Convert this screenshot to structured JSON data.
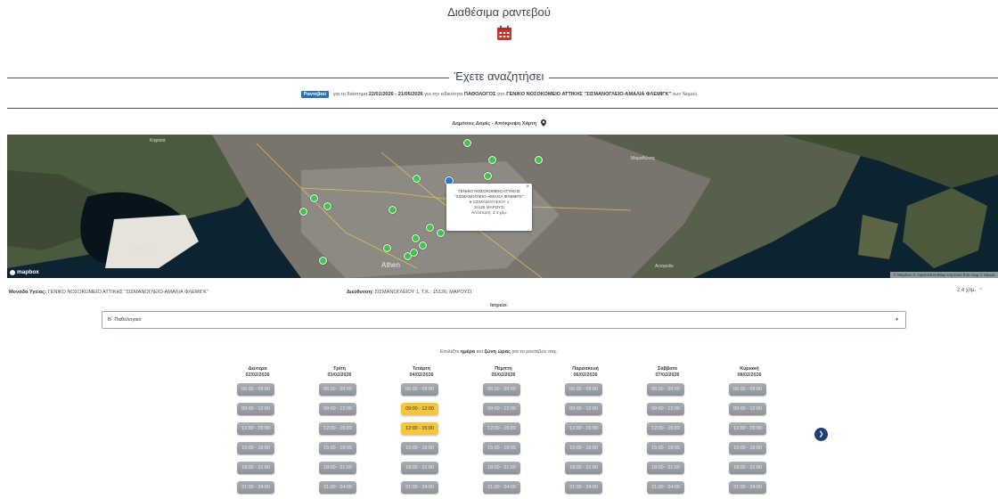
{
  "page_title": "Διαθέσιμα ραντεβού",
  "section_title": "Έχετε αναζητήσει",
  "search_summary": {
    "badge": "Ραντεβού",
    "text1": "για το διάστημα",
    "date_range": "22/01/2026 - 21/05/2026",
    "text2": "για την ειδικότητα",
    "specialty": "ΠΑΘΟΛΟΓΟΣ",
    "text3": "στο",
    "hospital": "ΓΕΝΙΚΟ ΝΟΣΟΚΟΜΕΙΟ ΑΤΤΙΚΗΣ \"ΣΙΣΜΑΝΟΓΛΕΙΟ-ΑΜΑΛΙΑ ΦΛΕΜΙΓΚ\"",
    "text4": "των Νομού"
  },
  "public_sort_label": "Δημόσιες Δομές - Απόκρυψη Χάρτη",
  "map": {
    "popup": {
      "line1": "ΓΕΝΙΚΟ ΝΟΣΟΚΟΜΕΙΟ ΑΤΤΙΚΗΣ",
      "line2": "\"ΣΙΣΜΑΝΟΓΛΕΙΟ-ΑΜΑΛΙΑ ΦΛΕΜΙΓΚ\"",
      "line3": "ΣΙΣΜΑΝΟΓΛΕΙΟΥ 1",
      "line4": "15126 ΜΑΡΟΥΣΙ",
      "line5": "Απόσταση: 2.4 χλμ.",
      "close": "×"
    },
    "labels": {
      "athen": "Athen",
      "kifisia": "Κηφισιά",
      "marathon": "Μαραθώνας",
      "acropolis": "Acropolis",
      "salamina": "Σαλαμίνα"
    },
    "logo": "mapbox",
    "attribution": "© Mapbox © OpenStreetMap Improve this map © Maxar"
  },
  "health_unit": {
    "label": "Μονάδα Υγείας:",
    "value": "ΓΕΝΙΚΟ ΝΟΣΟΚΟΜΕΙΟ ΑΤΤΙΚΗΣ \"ΣΙΣΜΑΝΟΓΛΕΙΟ-ΑΜΑΛΙΑ ΦΛΕΜΙΓΚ\""
  },
  "address": {
    "label": "Διεύθυνση:",
    "value": "ΣΙΣΜΑΝΟΓΛΕΙΟΥ 1, Τ.Κ.: 15126, ΜΑΡΟΥΣΙ"
  },
  "distance": "2.4 χλμ.",
  "doctor": {
    "label": "Ιατρείο:",
    "value": "Β΄ Παθολογικό"
  },
  "instruction": {
    "pre": "Επιλέξτε",
    "day": "ημέρα",
    "mid": "και",
    "zone": "ζώνη ώρας",
    "post": "για το ραντεβού σας:"
  },
  "days": [
    {
      "name": "Δευτέρα",
      "date": "02/02/2026"
    },
    {
      "name": "Τρίτη",
      "date": "03/02/2026"
    },
    {
      "name": "Τετάρτη",
      "date": "04/02/2026"
    },
    {
      "name": "Πέμπτη",
      "date": "05/02/2026"
    },
    {
      "name": "Παρασκευή",
      "date": "06/02/2026"
    },
    {
      "name": "Σάββατο",
      "date": "07/02/2026"
    },
    {
      "name": "Κυριακή",
      "date": "08/02/2026"
    }
  ],
  "time_slots": [
    "06:00 - 09:00",
    "09:00 - 12:00",
    "12:00 - 15:00",
    "15:00 - 18:00",
    "18:00 - 21:00",
    "21:00 - 24:00"
  ],
  "available": [
    {
      "day": 2,
      "slot": 1
    },
    {
      "day": 2,
      "slot": 2
    }
  ],
  "next_icon": "chevron-right-icon",
  "colors": {
    "available": "#f4c53f",
    "unavailable": "#9aa0a6",
    "accent": "#1f3f73",
    "calendar_icon": "#c0392b",
    "marker": "#3fc54a"
  }
}
